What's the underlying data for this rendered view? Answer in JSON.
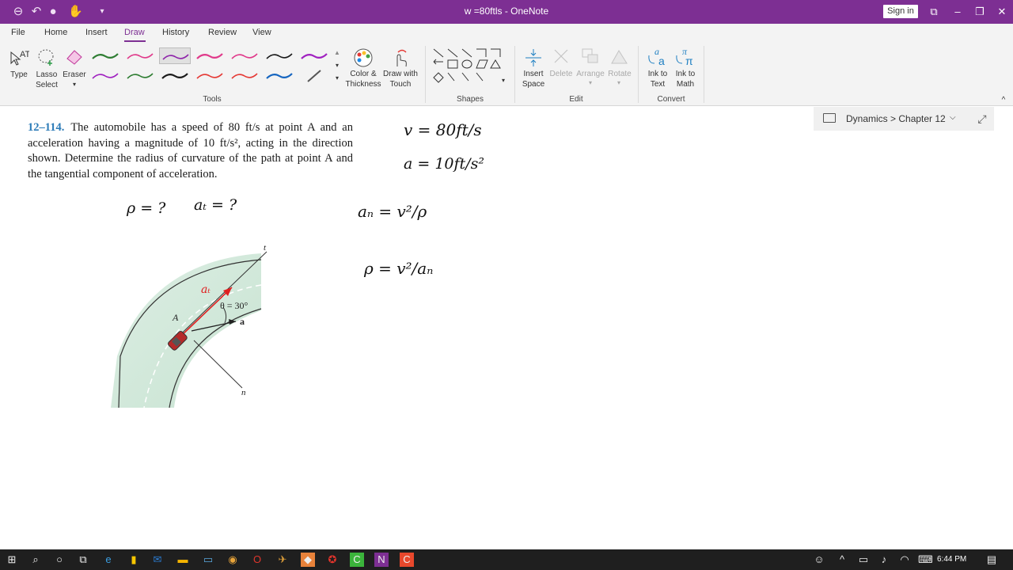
{
  "window": {
    "title": "w =80ftls - OneNote",
    "sign_in": "Sign in"
  },
  "tabs": [
    "File",
    "Home",
    "Insert",
    "Draw",
    "History",
    "Review",
    "View"
  ],
  "active_tab": "Draw",
  "ribbon": {
    "tools": {
      "type": "Type",
      "lasso": "Lasso\nSelect",
      "eraser": "Eraser",
      "group": "Tools"
    },
    "color_thickness": "Color &\nThickness",
    "draw_with_touch": "Draw with\nTouch",
    "shapes_group": "Shapes",
    "edit": {
      "insert_space": "Insert\nSpace",
      "delete": "Delete",
      "arrange": "Arrange",
      "rotate": "Rotate",
      "group": "Edit"
    },
    "convert": {
      "ink_to_text": "Ink to\nText",
      "ink_to_math": "Ink to\nMath",
      "group": "Convert"
    },
    "pen_colors": [
      "#2e7d32",
      "#e0398a",
      "#8e24aa",
      "#e0398a",
      "#e0398a",
      "#1a1a1a",
      "#a020c0",
      "#a020c0",
      "#2e7d32",
      "#1a1a1a",
      "#e53935",
      "#e53935",
      "#1565c0",
      "#555555"
    ]
  },
  "breadcrumb": "Dynamics > Chapter 12",
  "problem": {
    "number": "12–114.",
    "text": "The automobile has a speed of 80 ft/s at point A and an acceleration having a magnitude of 10 ft/s², acting in the direction shown. Determine the radius of curvature of the path at point A and the tangential component of acceleration."
  },
  "figure": {
    "t_label": "t",
    "n_label": "n",
    "a_label": "a",
    "A_label": "A",
    "theta_label": "θ = 30°"
  },
  "ink": {
    "v": "v = 80ft/s",
    "a": "a = 10ft/s²",
    "rho_q": "ρ = ?",
    "at_q": "aₜ = ?",
    "an_eq": "aₙ = v²/ρ",
    "rho_eq": "ρ = v²/aₙ",
    "at": "aₜ"
  },
  "taskbar": {
    "time": "6:44 PM"
  }
}
